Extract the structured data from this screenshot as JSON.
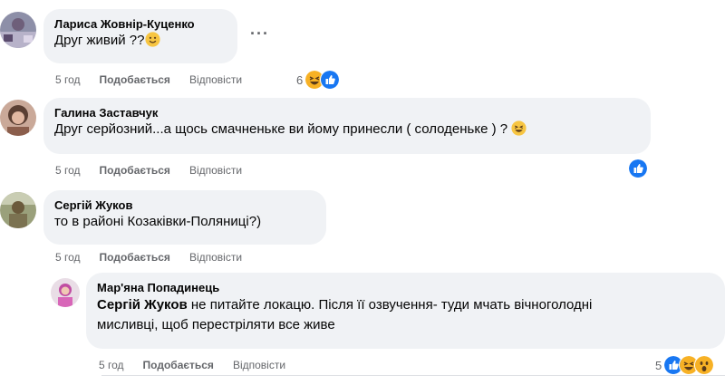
{
  "colors": {
    "bubble_bg": "#f0f2f5",
    "meta_text": "#65676b",
    "like_blue": "#1877f2",
    "haha_yellow": "#f7b125"
  },
  "comments": [
    {
      "author": "Лариса Жовнір-Куценко",
      "text": "Друг живий ??",
      "inline_emoji": "slightly-smiling-face-icon",
      "time": "5 год",
      "like_label": "Подобається",
      "reply_label": "Відповісти",
      "reaction_count": "6",
      "reactions": [
        "haha-icon",
        "like-icon"
      ],
      "more_label": "···"
    },
    {
      "author": "Галина Заставчук",
      "text": "Друг серйозний...а щось смачненьке ви йому принесли ( солоденьке ) ?",
      "inline_emoji": "grinning-face-icon",
      "time": "5 год",
      "like_label": "Подобається",
      "reply_label": "Відповісти",
      "reaction_count": "",
      "reactions": [
        "like-icon"
      ]
    },
    {
      "author": "Сергій Жуков",
      "text": "то в районі Козаківки-Поляниці?)",
      "time": "5 год",
      "like_label": "Подобається",
      "reply_label": "Відповісти"
    }
  ],
  "reply": {
    "author": "Мар'яна Попадинець",
    "mention": "Сергій Жуков",
    "text_line1": " не питайте локацю. Після її озвучення- туди мчать вічноголодні",
    "text_line2": "мисливці, щоб перестріляти все живе",
    "time": "5 год",
    "like_label": "Подобається",
    "reply_label": "Відповісти",
    "reaction_count": "5",
    "reactions": [
      "like-icon",
      "haha-icon",
      "wow-icon"
    ]
  }
}
